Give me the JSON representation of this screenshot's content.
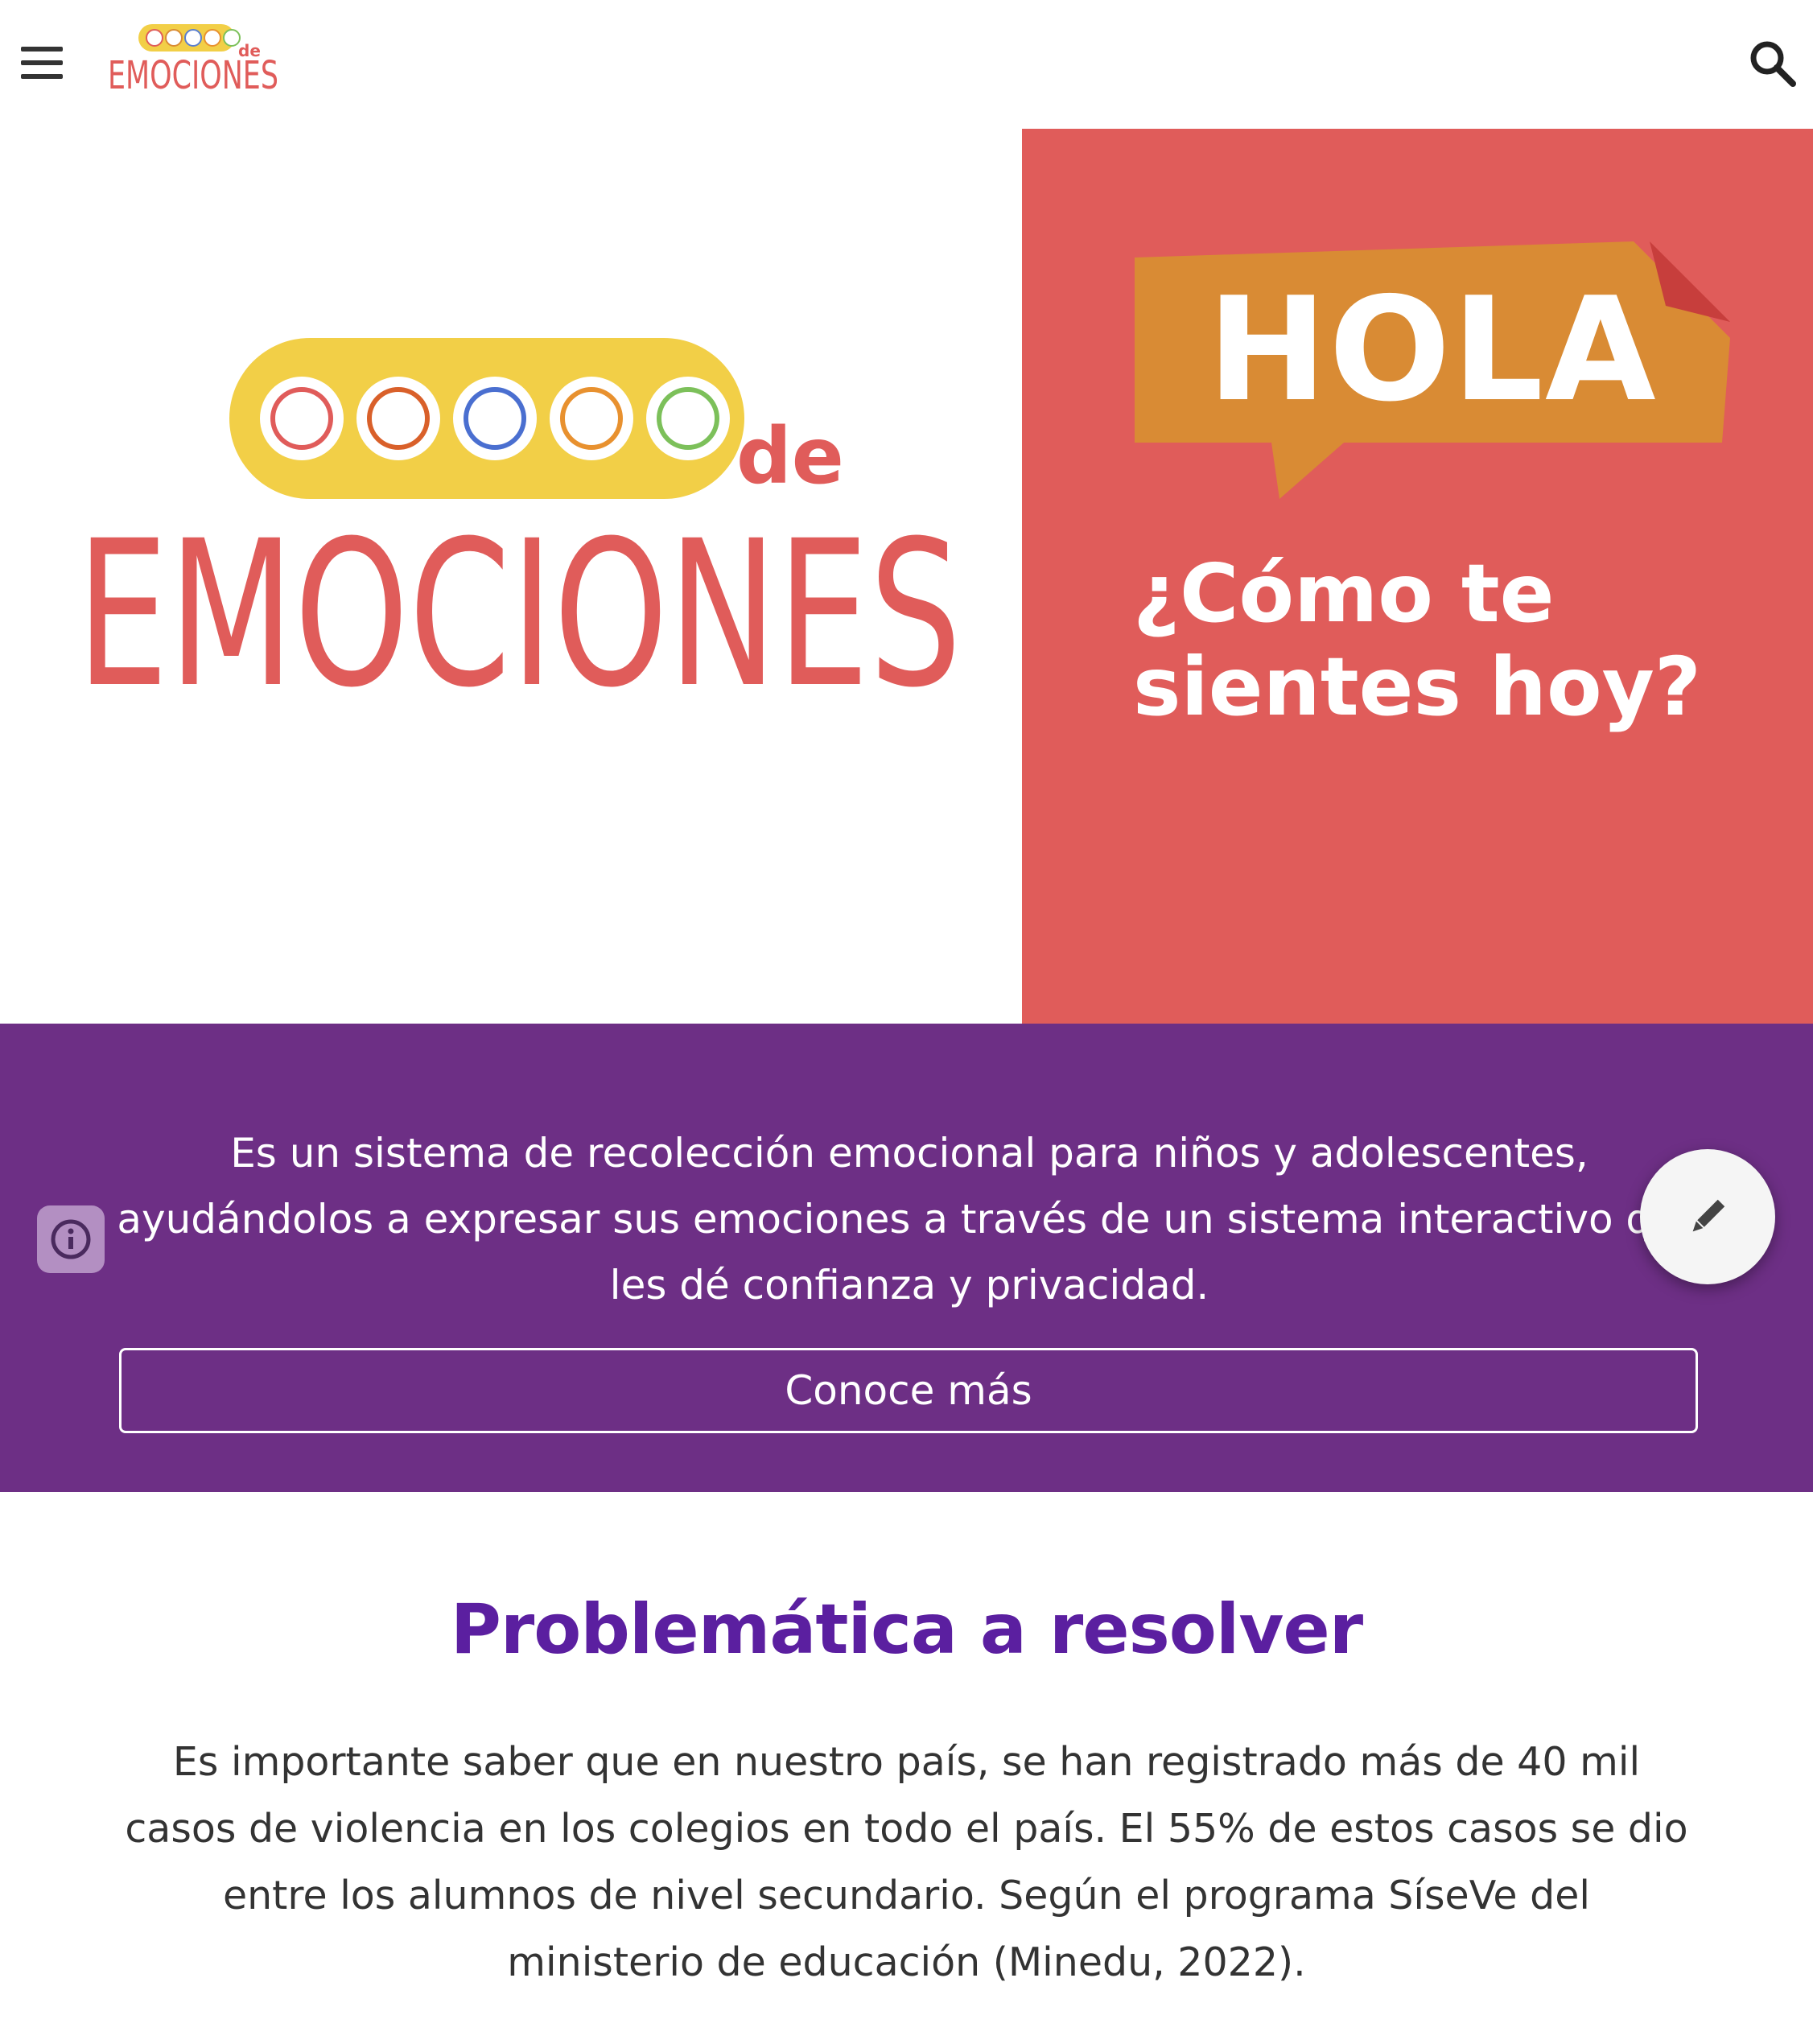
{
  "header": {
    "menu_icon": "hamburger-menu-icon",
    "logo_text_top": "de",
    "logo_text_main": "EMOCIONES",
    "search_icon": "search-icon"
  },
  "hero": {
    "logo_word_de": "de",
    "logo_word_main": "EMOCIONES",
    "hola": "HOLA",
    "question": "¿Cómo te sientes hoy?",
    "colors": {
      "panel": "#e05c5a",
      "bubble": "#d98b34",
      "logo_pill": "#f2cf47",
      "logo_text": "#e05c5a"
    }
  },
  "band": {
    "description": "Es un sistema de recolección emocional para niños y adolescentes, ayudándolos a expresar sus emociones a través de un sistema interactivo que les dé confianza y privacidad.",
    "cta_label": "Conoce más",
    "info_icon": "info-icon",
    "edit_icon": "pencil-icon",
    "color": "#6d2f85"
  },
  "problem": {
    "title": "Problemática a resolver",
    "body": "Es importante saber que en nuestro país, se han registrado más de 40 mil casos de violencia en los colegios en todo el país. El 55% de estos casos se dio entre los alumnos de nivel secundario. Según el programa SíseVe del ministerio de educación (Minedu, 2022).",
    "title_color": "#5b1fa0"
  }
}
